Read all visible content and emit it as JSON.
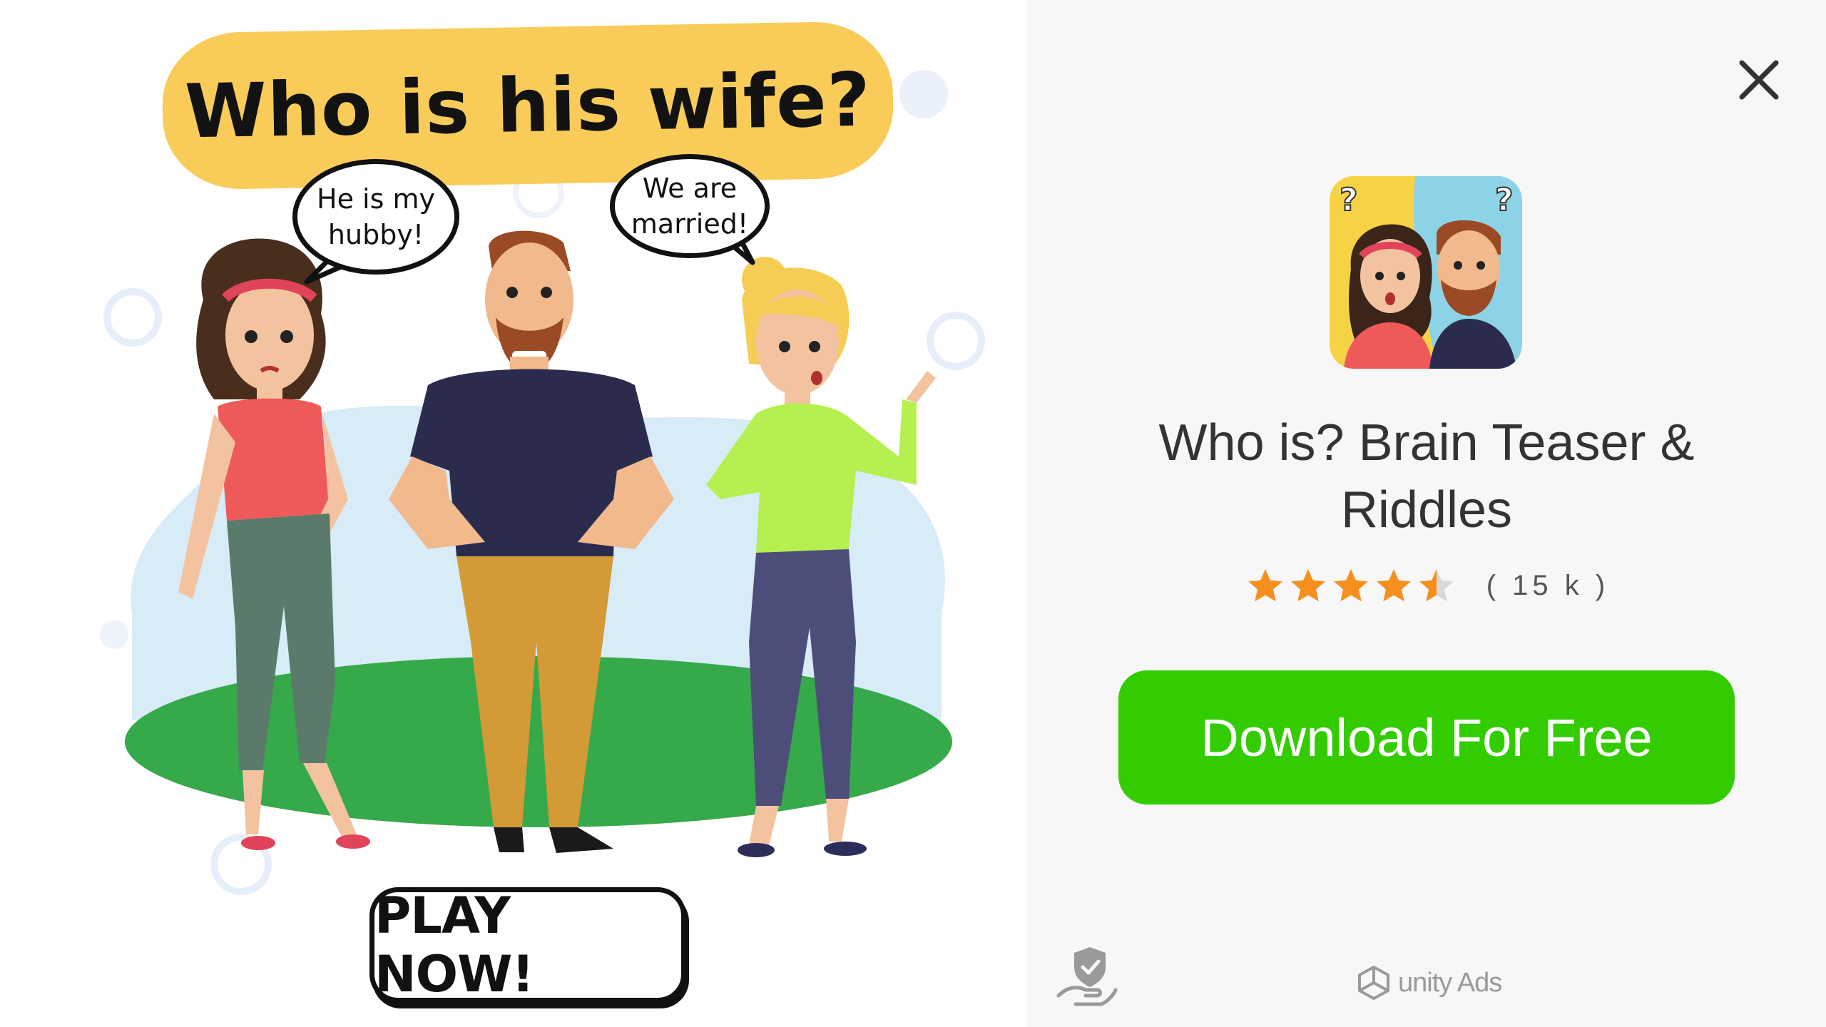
{
  "creative": {
    "headline": "Who is his wife?",
    "speech_left": [
      "He is my",
      "hubby!"
    ],
    "speech_right": [
      "We are",
      "married!"
    ],
    "cta": "PLAY NOW!"
  },
  "endcard": {
    "close_icon": "close-icon",
    "app_title_lines": [
      "Who is? Brain Teaser &",
      "Riddles"
    ],
    "rating": {
      "value": 4.5,
      "max": 5,
      "count": "( 15 k )"
    },
    "download_label": "Download For Free",
    "privacy_icon": "privacy-hand-shield-icon",
    "network_label": "unity Ads"
  },
  "colors": {
    "headline_bg": "#f9cc5a",
    "download_green": "#33cc00",
    "star_orange": "#f5901e",
    "endcard_bg": "#f7f7f7"
  }
}
